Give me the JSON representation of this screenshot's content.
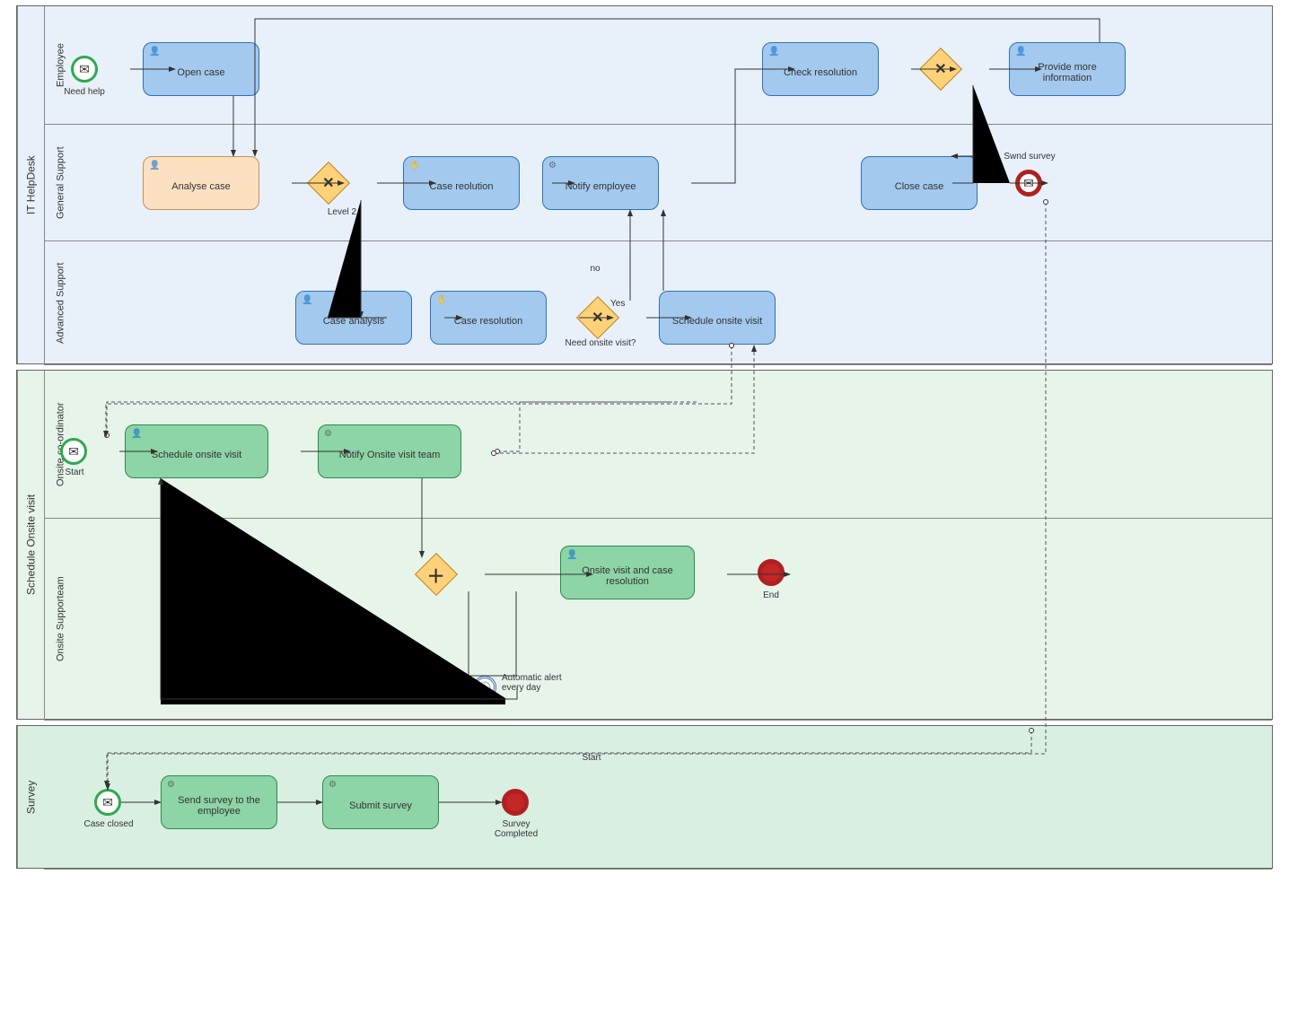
{
  "diagram_type": "BPMN process diagram",
  "pools": [
    {
      "id": "it",
      "title": "IT HelpDesk",
      "lanes": [
        "Employee",
        "General Support",
        "Advanced Support"
      ]
    },
    {
      "id": "sov",
      "title": "Schedule Onsite visit",
      "lanes": [
        "Onsite co-ordinator",
        "Onsite Supporteam"
      ]
    },
    {
      "id": "srv",
      "title": "Survey",
      "lanes": [
        ""
      ]
    }
  ],
  "events": {
    "need_help": "Need help",
    "swnd_survey": "Swnd survey",
    "start_sov": "Start",
    "end_sov": "End",
    "alert": "Automatic alert every day",
    "case_closed": "Case closed",
    "survey_start": "Start",
    "survey_done": "Survey Completed"
  },
  "tasks": {
    "open_case": "Open case",
    "analyse_case": "Analyse case",
    "case_reolution": "Case reolution",
    "notify_emp": "Notify employee",
    "check_res": "Check resolution",
    "provide_info": "Provide more information",
    "close_case": "Close case",
    "case_analysis": "Case analysis",
    "case_res2": "Case resolution",
    "sched_visit": "Schedule onsite visit",
    "sched_visit2": "Schedule onsite visit",
    "notify_team": "Notify Onsite visit team",
    "onsite_res": "Onsite visit and case resolution",
    "send_survey": "Send survey to the employee",
    "submit_survey": "Submit survey"
  },
  "gateway_labels": {
    "level2": "Level 2",
    "need_onsite": "Need onsite visit?",
    "yes": "Yes",
    "no": "no"
  }
}
